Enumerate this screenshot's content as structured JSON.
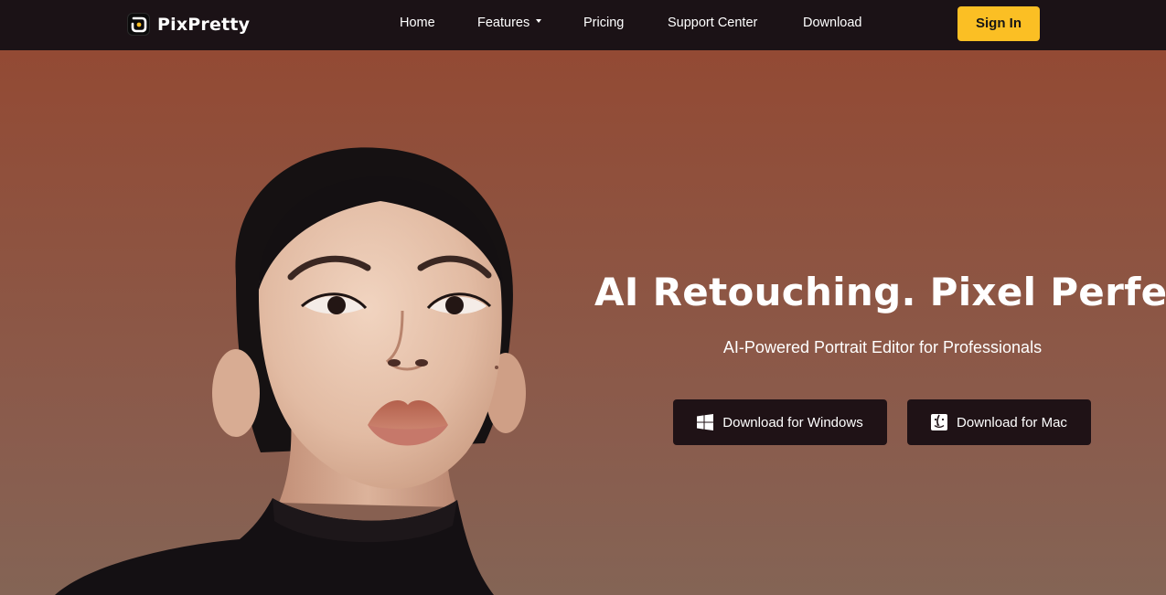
{
  "brand": {
    "name": "PixPretty",
    "accent": "#fbbf24",
    "nav_bg": "#1b1216"
  },
  "nav": {
    "links": [
      {
        "label": "Home"
      },
      {
        "label": "Features",
        "has_dropdown": true
      },
      {
        "label": "Pricing"
      },
      {
        "label": "Support Center"
      },
      {
        "label": "Download"
      }
    ],
    "signin_label": "Sign In"
  },
  "hero": {
    "headline": "AI Retouching. Pixel Perfect",
    "subheadline": "AI-Powered Portrait Editor for Professionals",
    "buttons": {
      "windows": {
        "label": "Download for Windows",
        "icon": "windows-icon"
      },
      "mac": {
        "label": "Download for Mac",
        "icon": "mac-finder-icon"
      }
    },
    "image": {
      "subject": "portrait-photo",
      "background_color": "#8e5340"
    }
  }
}
